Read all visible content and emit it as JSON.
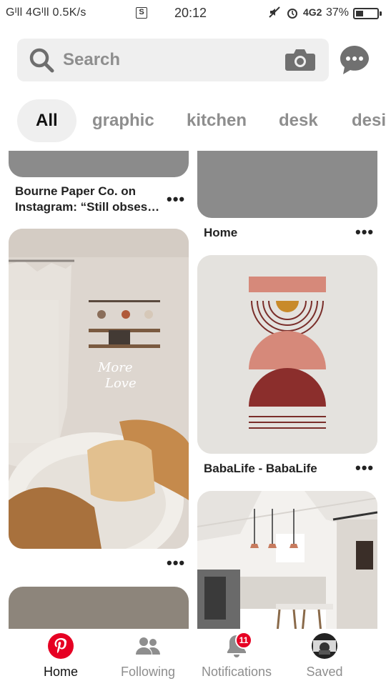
{
  "status_bar": {
    "signal": "Gᴵll 4Gᴵll",
    "speed": "0.5K/s",
    "s_icon": "S",
    "time": "20:12",
    "network": "4G2",
    "battery": "37%",
    "battery_level": 0.37
  },
  "search": {
    "placeholder": "Search"
  },
  "chips": [
    "All",
    "graphic",
    "kitchen",
    "desk",
    "design"
  ],
  "pins": {
    "bourne": {
      "title_line1": "Bourne Paper Co. on",
      "title_line2": "Instagram: “Still obses…"
    },
    "home": {
      "title": "Home"
    },
    "babalife": {
      "title": "BabaLife - BabaLife"
    },
    "more": "•••"
  },
  "image_text": {
    "neon": "More Love"
  },
  "bottom_nav": {
    "home": "Home",
    "following": "Following",
    "notifications": "Notifications",
    "notifications_badge": "11",
    "saved": "Saved"
  },
  "colors": {
    "brand": "#e60023",
    "placeholder_gray": "#8e8e8e",
    "search_bg": "#efefef"
  },
  "icons": [
    "search-icon",
    "camera-icon",
    "chat-icon",
    "pinterest-logo-icon",
    "people-icon",
    "bell-icon",
    "avatar"
  ]
}
